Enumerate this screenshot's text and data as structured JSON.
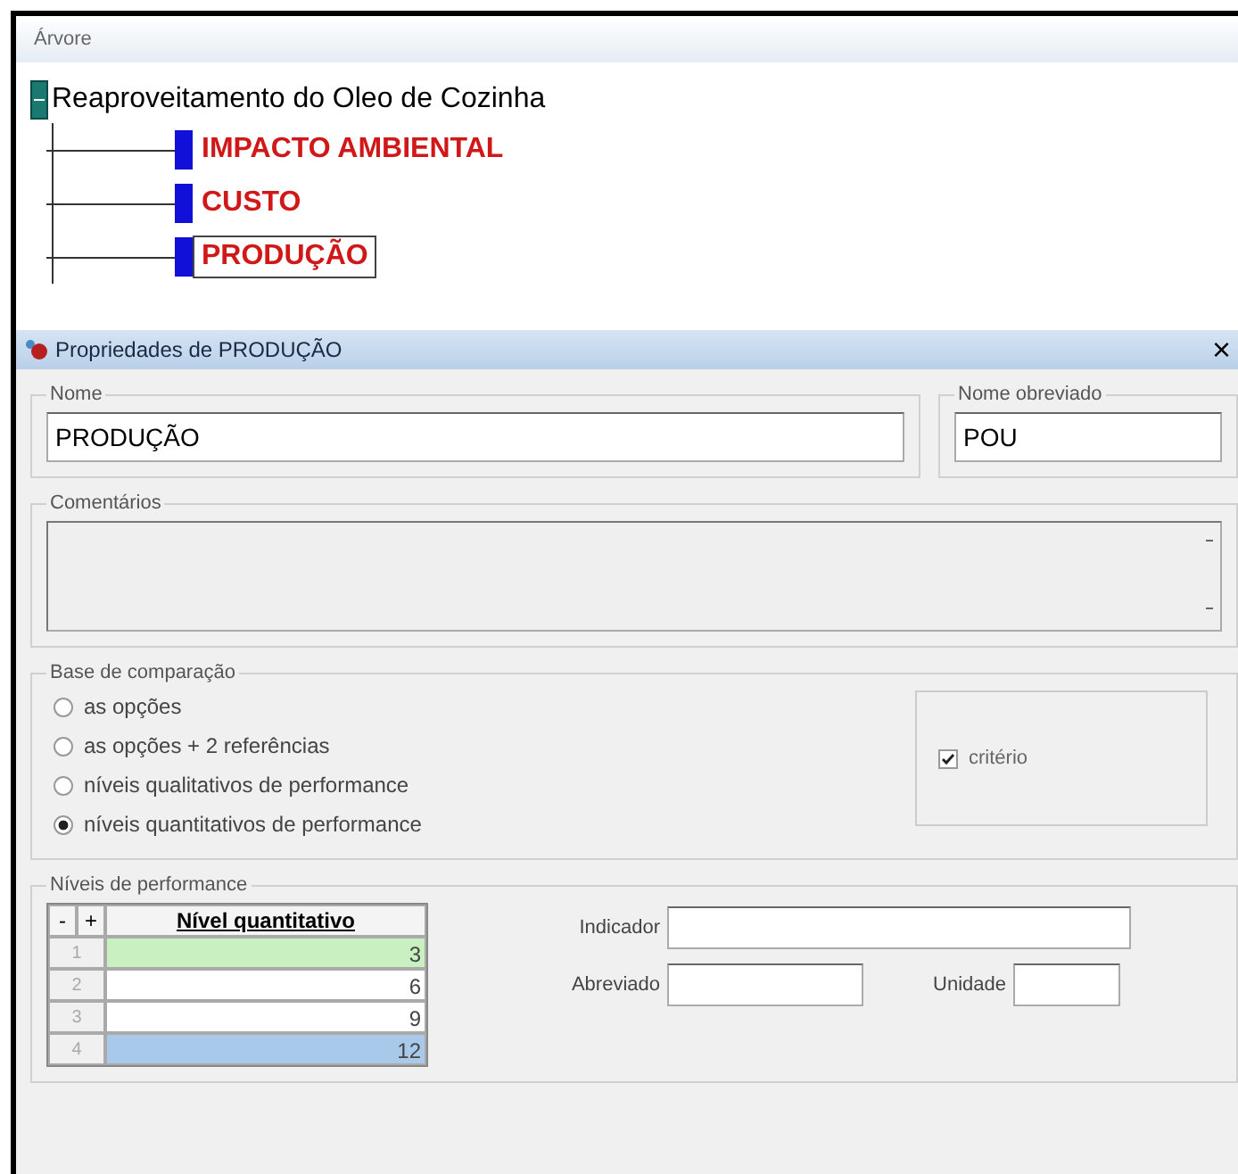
{
  "tree": {
    "title": "Árvore",
    "root": {
      "label": "Reaproveitamento do Oleo de Cozinha",
      "expanded": true,
      "children": [
        {
          "label": "IMPACTO AMBIENTAL",
          "selected": false
        },
        {
          "label": "CUSTO",
          "selected": false
        },
        {
          "label": "PRODUÇÃO",
          "selected": true
        }
      ]
    }
  },
  "dialog": {
    "title": "Propriedades de  PRODUÇÃO",
    "close": "×",
    "name": {
      "label": "Nome",
      "value": "PRODUÇÃO"
    },
    "short_name": {
      "label": "Nome obreviado",
      "value": "POU"
    },
    "comments": {
      "label": "Comentários"
    },
    "comparison": {
      "label": "Base de comparação",
      "options": [
        {
          "label": "as opções",
          "selected": false
        },
        {
          "label": "as opções + 2 referências",
          "selected": false
        },
        {
          "label": "níveis qualitativos de performance",
          "selected": false
        },
        {
          "label": "níveis quantitativos de performance",
          "selected": true
        }
      ],
      "criterion": {
        "label": "critério",
        "checked": true
      }
    },
    "levels": {
      "label": "Níveis de performance",
      "minus": "-",
      "plus": "+",
      "column": "Nível quantitativo",
      "rows": [
        {
          "index": "1",
          "value": "3",
          "color": "#c8f0c0"
        },
        {
          "index": "2",
          "value": "6"
        },
        {
          "index": "3",
          "value": "9"
        },
        {
          "index": "4",
          "value": "12",
          "color": "#a9c9ea"
        }
      ],
      "indicator": {
        "label": "Indicador"
      },
      "abbrev": {
        "label": "Abreviado"
      },
      "unit": {
        "label": "Unidade"
      }
    }
  }
}
